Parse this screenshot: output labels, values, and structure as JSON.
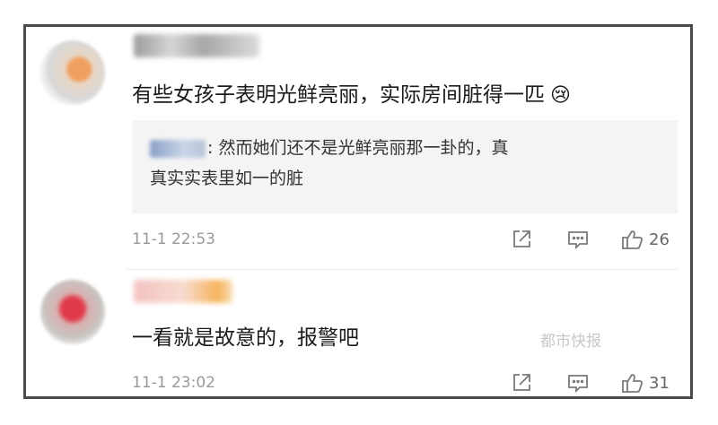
{
  "comments": [
    {
      "text": "有些女孩子表明光鲜亮丽，实际房间脏得一匹",
      "emoji_icon": "crying-emoji-icon",
      "reply": {
        "text_line1": "然而她们还不是光鲜亮丽那一卦的，真",
        "text_line2": "真实实表里如一的脏"
      },
      "timestamp": "11-1 22:53",
      "likes": "26"
    },
    {
      "text": "一看就是故意的，报警吧",
      "timestamp": "11-1 23:02",
      "likes": "31"
    }
  ],
  "reply_colon": ":",
  "watermark": "都市快报"
}
